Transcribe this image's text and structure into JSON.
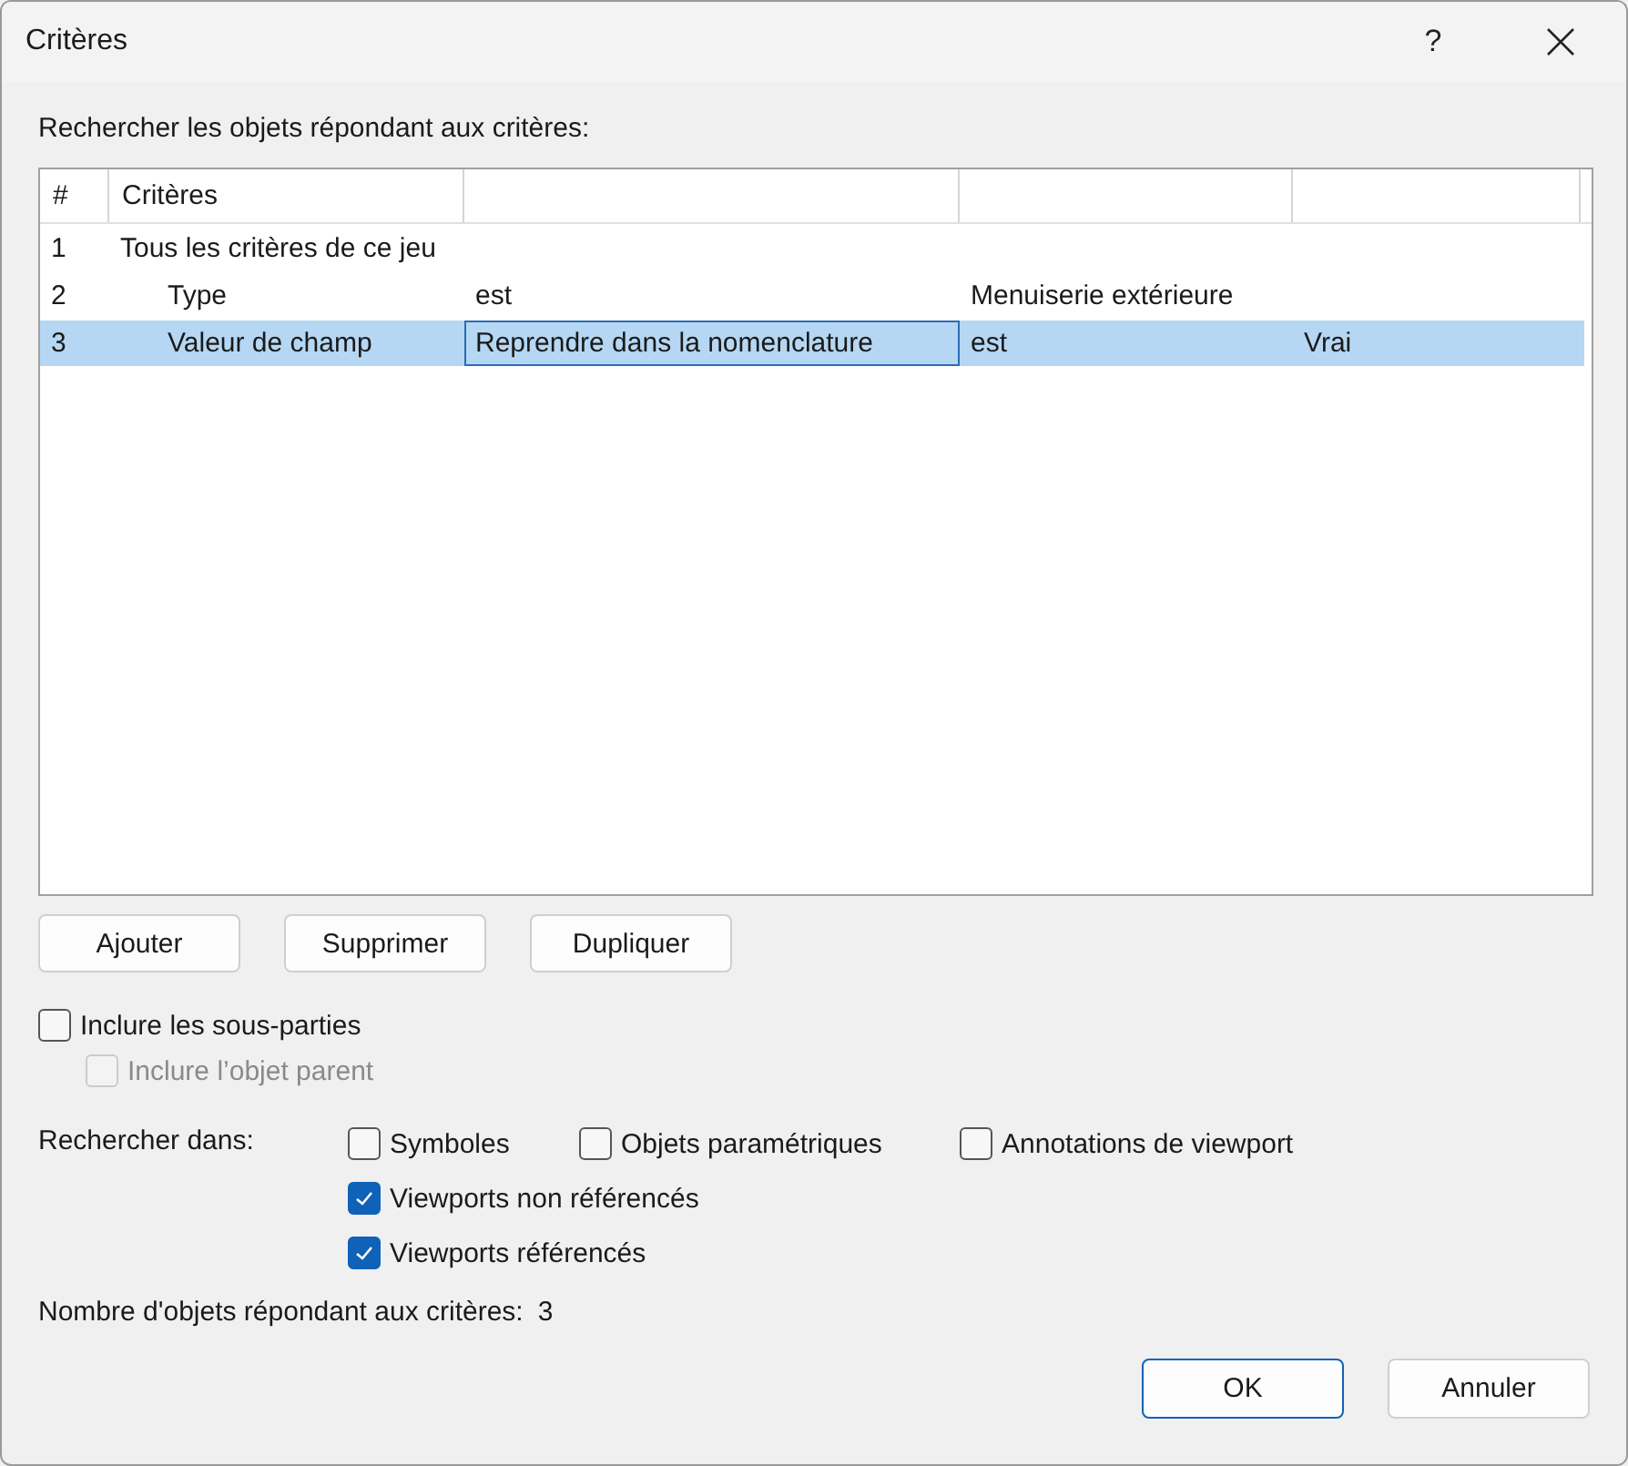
{
  "window": {
    "title": "Critères",
    "help": "?"
  },
  "prompt": "Rechercher les objets répondant aux critères:",
  "table": {
    "columns": [
      "#",
      "Critères",
      "",
      "",
      ""
    ],
    "rows": [
      {
        "number": "1",
        "label": "Tous les critères de ce jeu",
        "selected": false,
        "cells": [],
        "children": [
          {
            "number": "2",
            "label": "Type",
            "selected": false,
            "cells": [
              {
                "text": "est",
                "focused": false
              },
              {
                "text": "Menuiserie extérieure",
                "focused": false
              }
            ]
          },
          {
            "number": "3",
            "label": "Valeur de champ",
            "selected": true,
            "cells": [
              {
                "text": "Reprendre dans la nomenclature",
                "focused": true
              },
              {
                "text": "est",
                "focused": false
              },
              {
                "text": "Vrai",
                "focused": false
              }
            ]
          }
        ]
      }
    ]
  },
  "row_buttons": [
    "Ajouter",
    "Supprimer",
    "Dupliquer"
  ],
  "include": [
    {
      "label": "Inclure les sous-parties",
      "checked": false,
      "disabled": false,
      "children": [
        {
          "label": "Inclure l’objet parent",
          "checked": false,
          "disabled": true
        }
      ]
    }
  ],
  "search_in": {
    "label": "Rechercher dans:",
    "options": [
      {
        "label": "Symboles",
        "checked": false
      },
      {
        "label": "Objets paramétriques",
        "checked": false
      },
      {
        "label": "Annotations de viewport",
        "checked": false
      },
      {
        "label": "Viewports non référencés",
        "checked": true
      },
      {
        "label": "Viewports référencés",
        "checked": true
      }
    ]
  },
  "count": {
    "label": "Nombre d'objets répondant aux critères:",
    "value": "3"
  },
  "buttons": [
    {
      "label": "OK",
      "default": true
    },
    {
      "label": "Annuler",
      "default": false
    }
  ]
}
